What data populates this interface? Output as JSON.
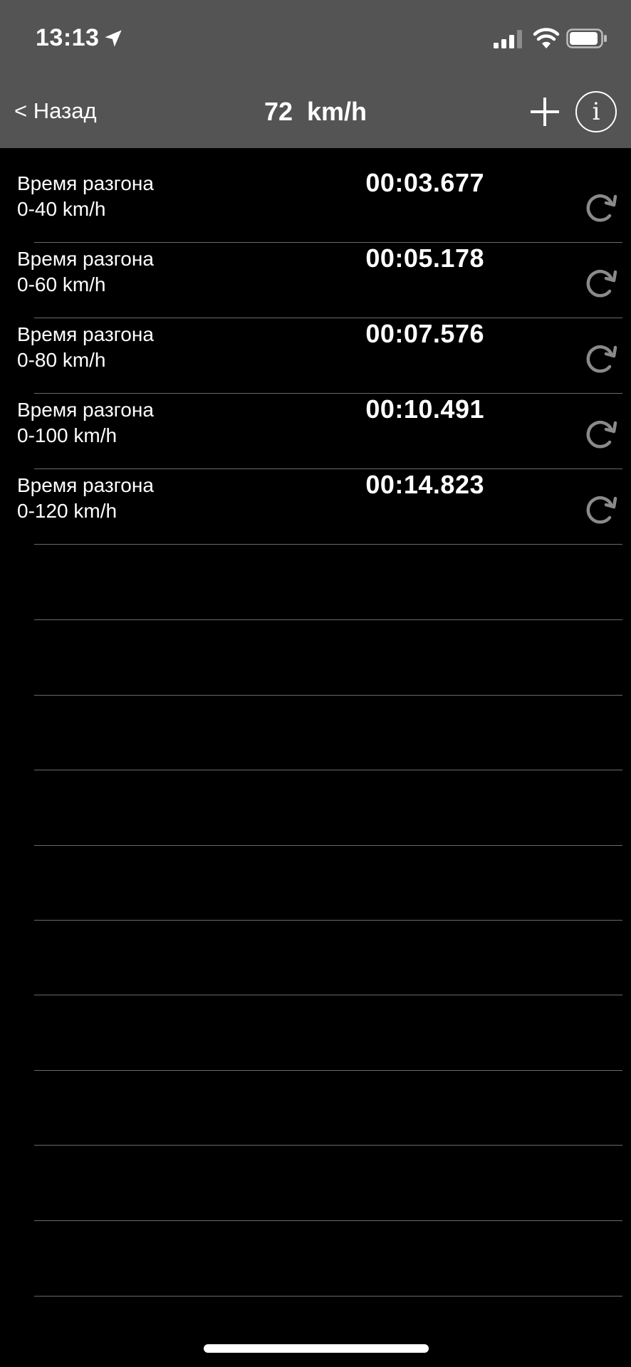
{
  "status_bar": {
    "time": "13:13",
    "icons": [
      "location-arrow-icon",
      "signal-icon",
      "wifi-icon",
      "battery-icon"
    ]
  },
  "nav": {
    "back_label": "< Назад",
    "title": "72  km/h",
    "add_icon": "plus-icon",
    "info_icon": "info-icon",
    "info_glyph": "i"
  },
  "rows": [
    {
      "line1": "Время разгона",
      "line2": "0-40 km/h",
      "time": "00:03.677"
    },
    {
      "line1": "Время разгона",
      "line2": "0-60 km/h",
      "time": "00:05.178"
    },
    {
      "line1": "Время разгона",
      "line2": "0-80 km/h",
      "time": "00:07.576"
    },
    {
      "line1": "Время разгона",
      "line2": "0-100 km/h",
      "time": "00:10.491"
    },
    {
      "line1": "Время разгона",
      "line2": "0-120 km/h",
      "time": "00:14.823"
    }
  ],
  "colors": {
    "header_bg": "#545454",
    "background": "#000000",
    "separator": "#6a6a6a",
    "reset_icon": "#8a8a8a"
  }
}
